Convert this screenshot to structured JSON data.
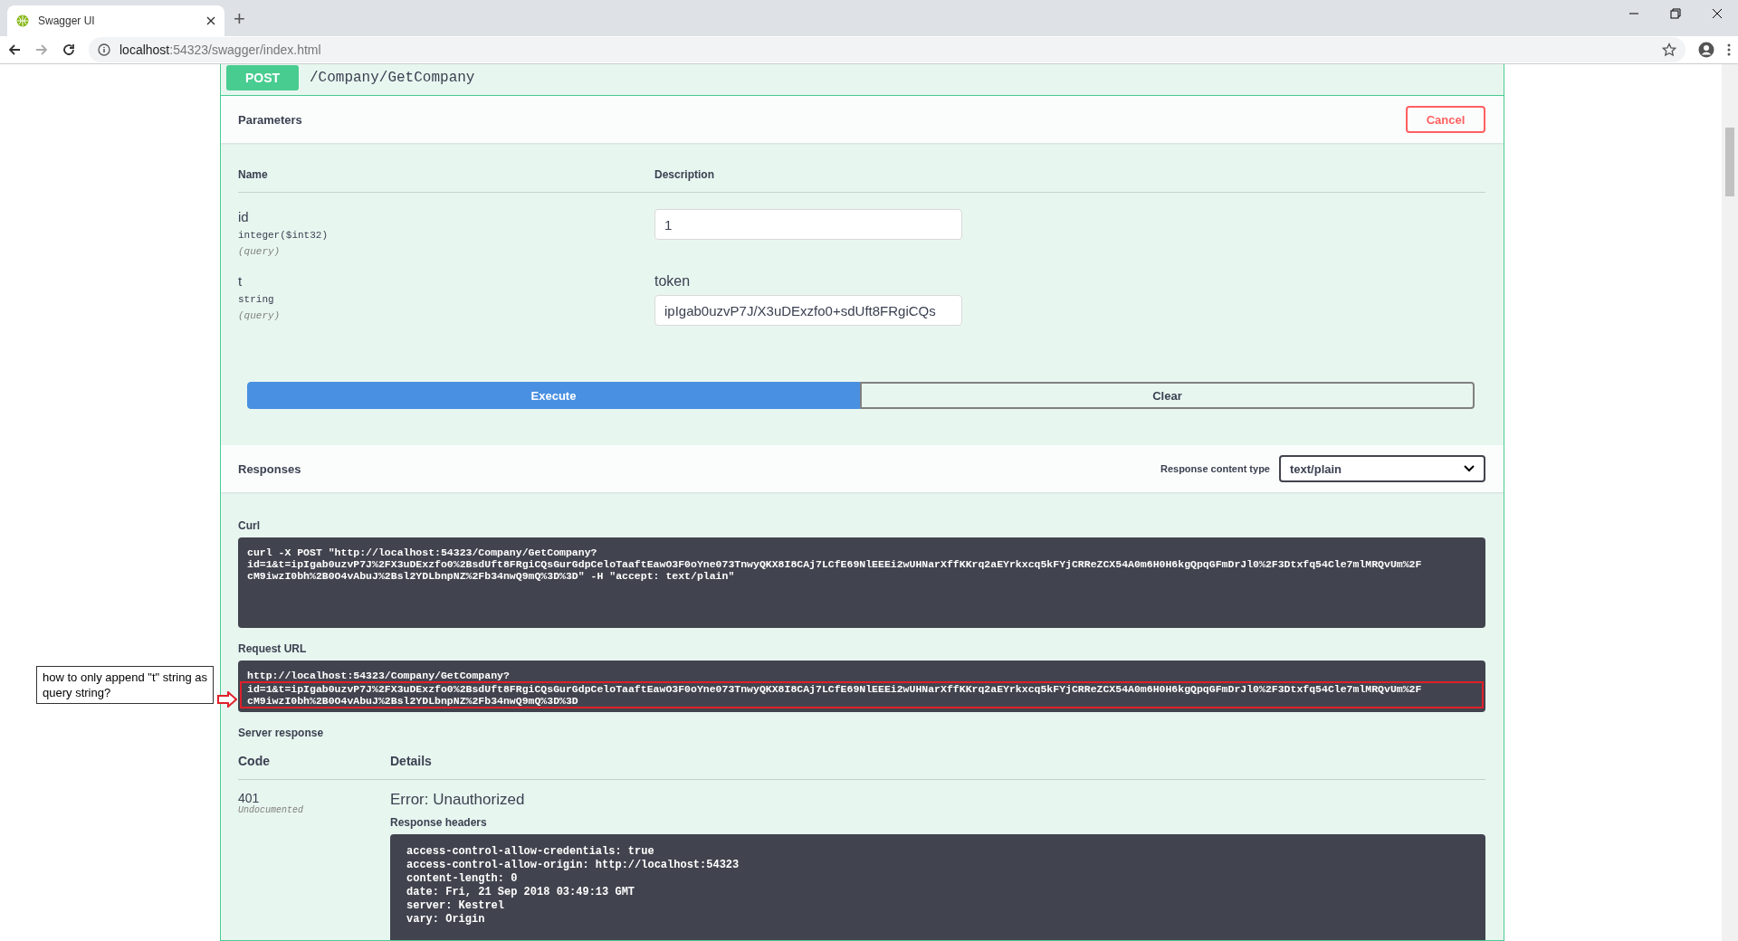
{
  "browser": {
    "tab_title": "Swagger UI",
    "new_tab": "+",
    "url_host": "localhost",
    "url_rest": ":54323/swagger/index.html"
  },
  "operation": {
    "method": "POST",
    "path": "/Company/GetCompany"
  },
  "parameters": {
    "title": "Parameters",
    "cancel": "Cancel",
    "columns": [
      "Name",
      "Description"
    ],
    "items": [
      {
        "name": "id",
        "type": "integer($int32)",
        "location": "(query)",
        "value": "1"
      },
      {
        "name": "t",
        "type": "string",
        "location": "(query)",
        "description": "token",
        "value": "ipIgab0uzvP7J/X3uDExzfo0+sdUft8FRgiCQs"
      }
    ]
  },
  "actions": [
    {
      "label": "Execute",
      "kind": "primary"
    },
    {
      "label": "Clear",
      "kind": "secondary"
    }
  ],
  "responses": {
    "title": "Responses",
    "content_type_label": "Response content type",
    "content_type": "text/plain"
  },
  "curl": {
    "label": "Curl",
    "lines": [
      "curl -X POST \"http://localhost:54323/Company/GetCompany?",
      "id=1&t=ipIgab0uzvP7J%2FX3uDExzfo0%2BsdUft8FRgiCQsGurGdpCeloTaaftEawO3F0oYne073TnwyQKX8I8CAj7LCfE69NlEEEi2wUHNarXffKKrq2aEYrkxcq5kFYjCRReZCX54A0m6H0H6kgQpqGFmDrJl0%2F3Dtxfq54Cle7mlMRQvUm%2F",
      "cM9iwzI0bh%2B0O4vAbuJ%2Bsl2YDLbnpNZ%2Fb34nwQ9mQ%3D%3D\" -H \"accept: text/plain\""
    ]
  },
  "request_url": {
    "label": "Request URL",
    "lines": [
      {
        "text": "http://localhost:54323/Company/GetCompany?",
        "highlighted": false
      },
      {
        "text": "id=1&t=ipIgab0uzvP7J%2FX3uDExzfo0%2BsdUft8FRgiCQsGurGdpCeloTaaftEawO3F0oYne073TnwyQKX8I8CAj7LCfE69NlEEEi2wUHNarXffKKrq2aEYrkxcq5kFYjCRReZCX54A0m6H0H6kgQpqGFmDrJl0%2F3Dtxfq54Cle7mlMRQvUm%2F",
        "highlighted": true
      },
      {
        "text": "cM9iwzI0bh%2B0O4vAbuJ%2Bsl2YDLbnpNZ%2Fb34nwQ9mQ%3D%3D",
        "highlighted": true
      }
    ]
  },
  "server_response": {
    "title": "Server response",
    "columns": [
      "Code",
      "Details"
    ],
    "code": "401",
    "code_note": "Undocumented",
    "error": "Error: Unauthorized",
    "headers_label": "Response headers",
    "headers": [
      "access-control-allow-credentials: true",
      "access-control-allow-origin: http://localhost:54323",
      "content-length: 0",
      "date: Fri, 21 Sep 2018 03:49:13 GMT",
      "server: Kestrel",
      "vary: Origin"
    ]
  },
  "annotation": {
    "text": "how to only append \"t\" string as query string?"
  }
}
